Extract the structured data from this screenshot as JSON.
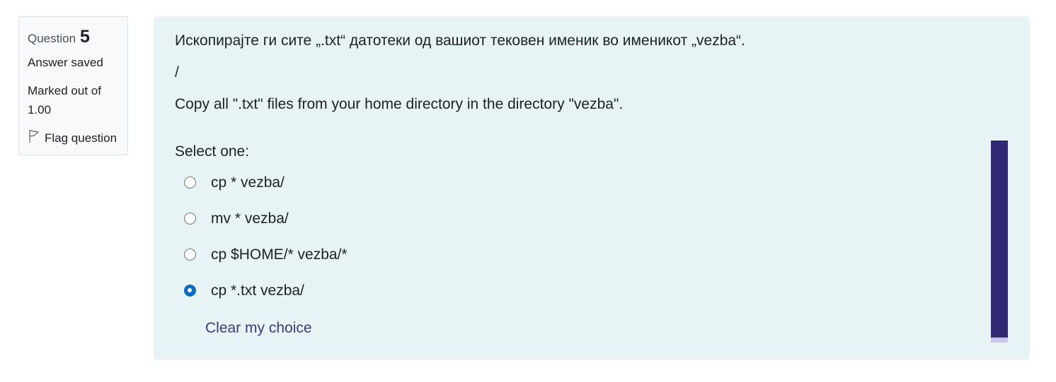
{
  "info": {
    "question_label": "Question",
    "question_number": "5",
    "state": "Answer saved",
    "grade": "Marked out of 1.00",
    "flag_label": "Flag question"
  },
  "question": {
    "text_mk": "Ископирајте ги сите „.txt“ датотеки од вашиот тековен именик во именикот „vezba“.",
    "separator": "/",
    "text_en": "Copy all \".txt\" files from your home directory in the directory \"vezba\".",
    "prompt": "Select one:",
    "options": [
      {
        "label": "cp * vezba/",
        "selected": false
      },
      {
        "label": "mv * vezba/",
        "selected": false
      },
      {
        "label": "cp $HOME/* vezba/*",
        "selected": false
      },
      {
        "label": "cp *.txt vezba/",
        "selected": true
      }
    ],
    "clear_label": "Clear my choice"
  },
  "colors": {
    "content_bg": "#e7f3f5",
    "radio_selected": "#0f6cbf",
    "link": "#3d3a7e",
    "scrollbar_thumb": "#302a75",
    "scrollbar_track": "#c9c4ec"
  }
}
